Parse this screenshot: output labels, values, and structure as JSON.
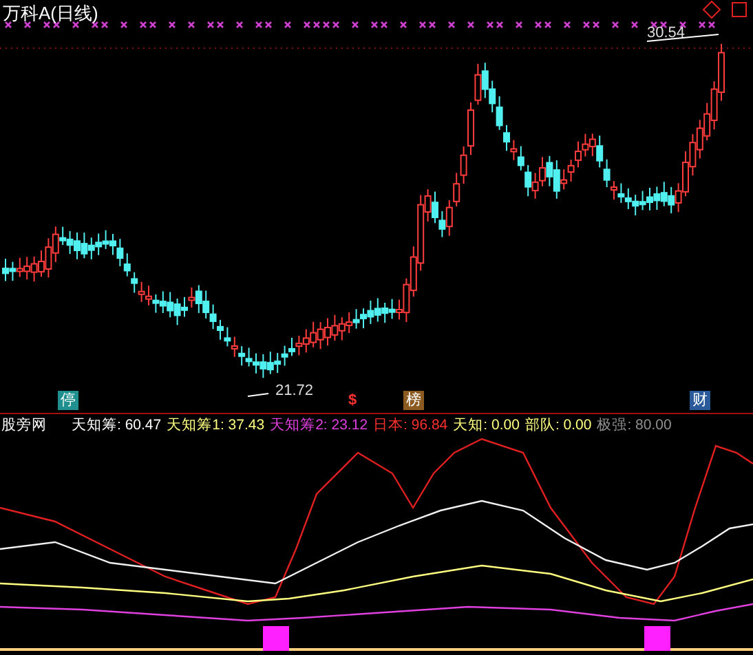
{
  "window": {
    "title": "万科A(日线)"
  },
  "price_chart": {
    "high_label": "30.54",
    "low_label": "21.72",
    "markers": [
      {
        "kind": "badge",
        "text": "停",
        "color": "#1f8f8f"
      },
      {
        "kind": "glyph",
        "text": "$",
        "color": "#ff3030"
      },
      {
        "kind": "badge",
        "text": "榜",
        "color": "#8a5a20"
      },
      {
        "kind": "badge",
        "text": "财",
        "color": "#2a5a9a"
      }
    ]
  },
  "indicator": {
    "name": "股旁网",
    "readouts": [
      {
        "label": "天知筹: 60.47",
        "color": "#ffffff"
      },
      {
        "label": "天知筹1: 37.43",
        "color": "#ffff80"
      },
      {
        "label": "天知筹2: 23.12",
        "color": "#e040e0"
      },
      {
        "label": "日本: 96.84",
        "color": "#ff3030"
      },
      {
        "label": "天知: 0.00",
        "color": "#ffff80"
      },
      {
        "label": "部队: 0.00",
        "color": "#ffff80"
      },
      {
        "label": "极强: 80.00",
        "color": "#909090"
      }
    ]
  }
}
